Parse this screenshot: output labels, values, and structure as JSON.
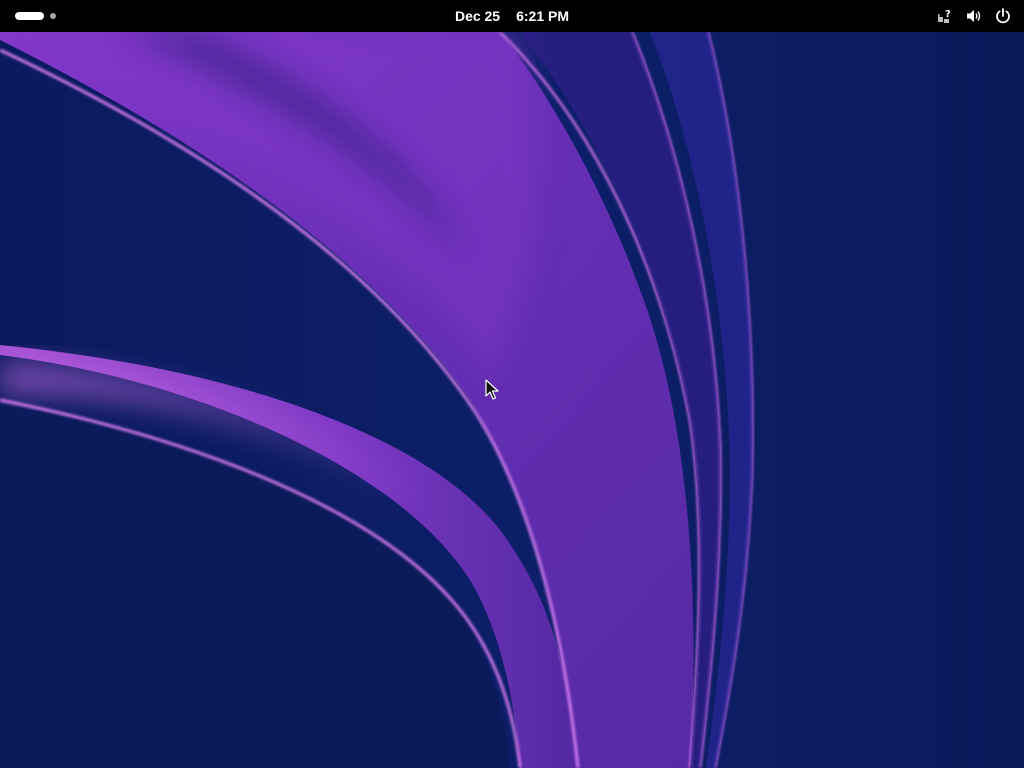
{
  "top_bar": {
    "date": "Dec 25",
    "time": "6:21 PM",
    "background": "#000000"
  },
  "activities": {
    "workspace_count": 2,
    "active_workspace": 1
  },
  "system_tray": {
    "icons": [
      "network-unknown-icon",
      "volume-icon",
      "power-icon"
    ]
  },
  "wallpaper": {
    "base_color": "#0c1a5c",
    "accent_color": "#9b3fd1",
    "highlight_color": "#d26cf0"
  }
}
